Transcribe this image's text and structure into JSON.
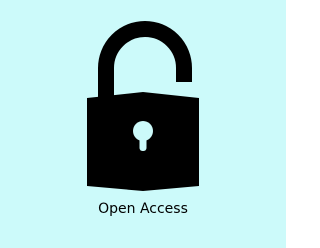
{
  "card": {
    "caption": "Open Access",
    "icon": "unlocked-padlock-icon",
    "colors": {
      "background": "#ccfafa",
      "icon": "#000000",
      "caption": "#000000"
    }
  }
}
